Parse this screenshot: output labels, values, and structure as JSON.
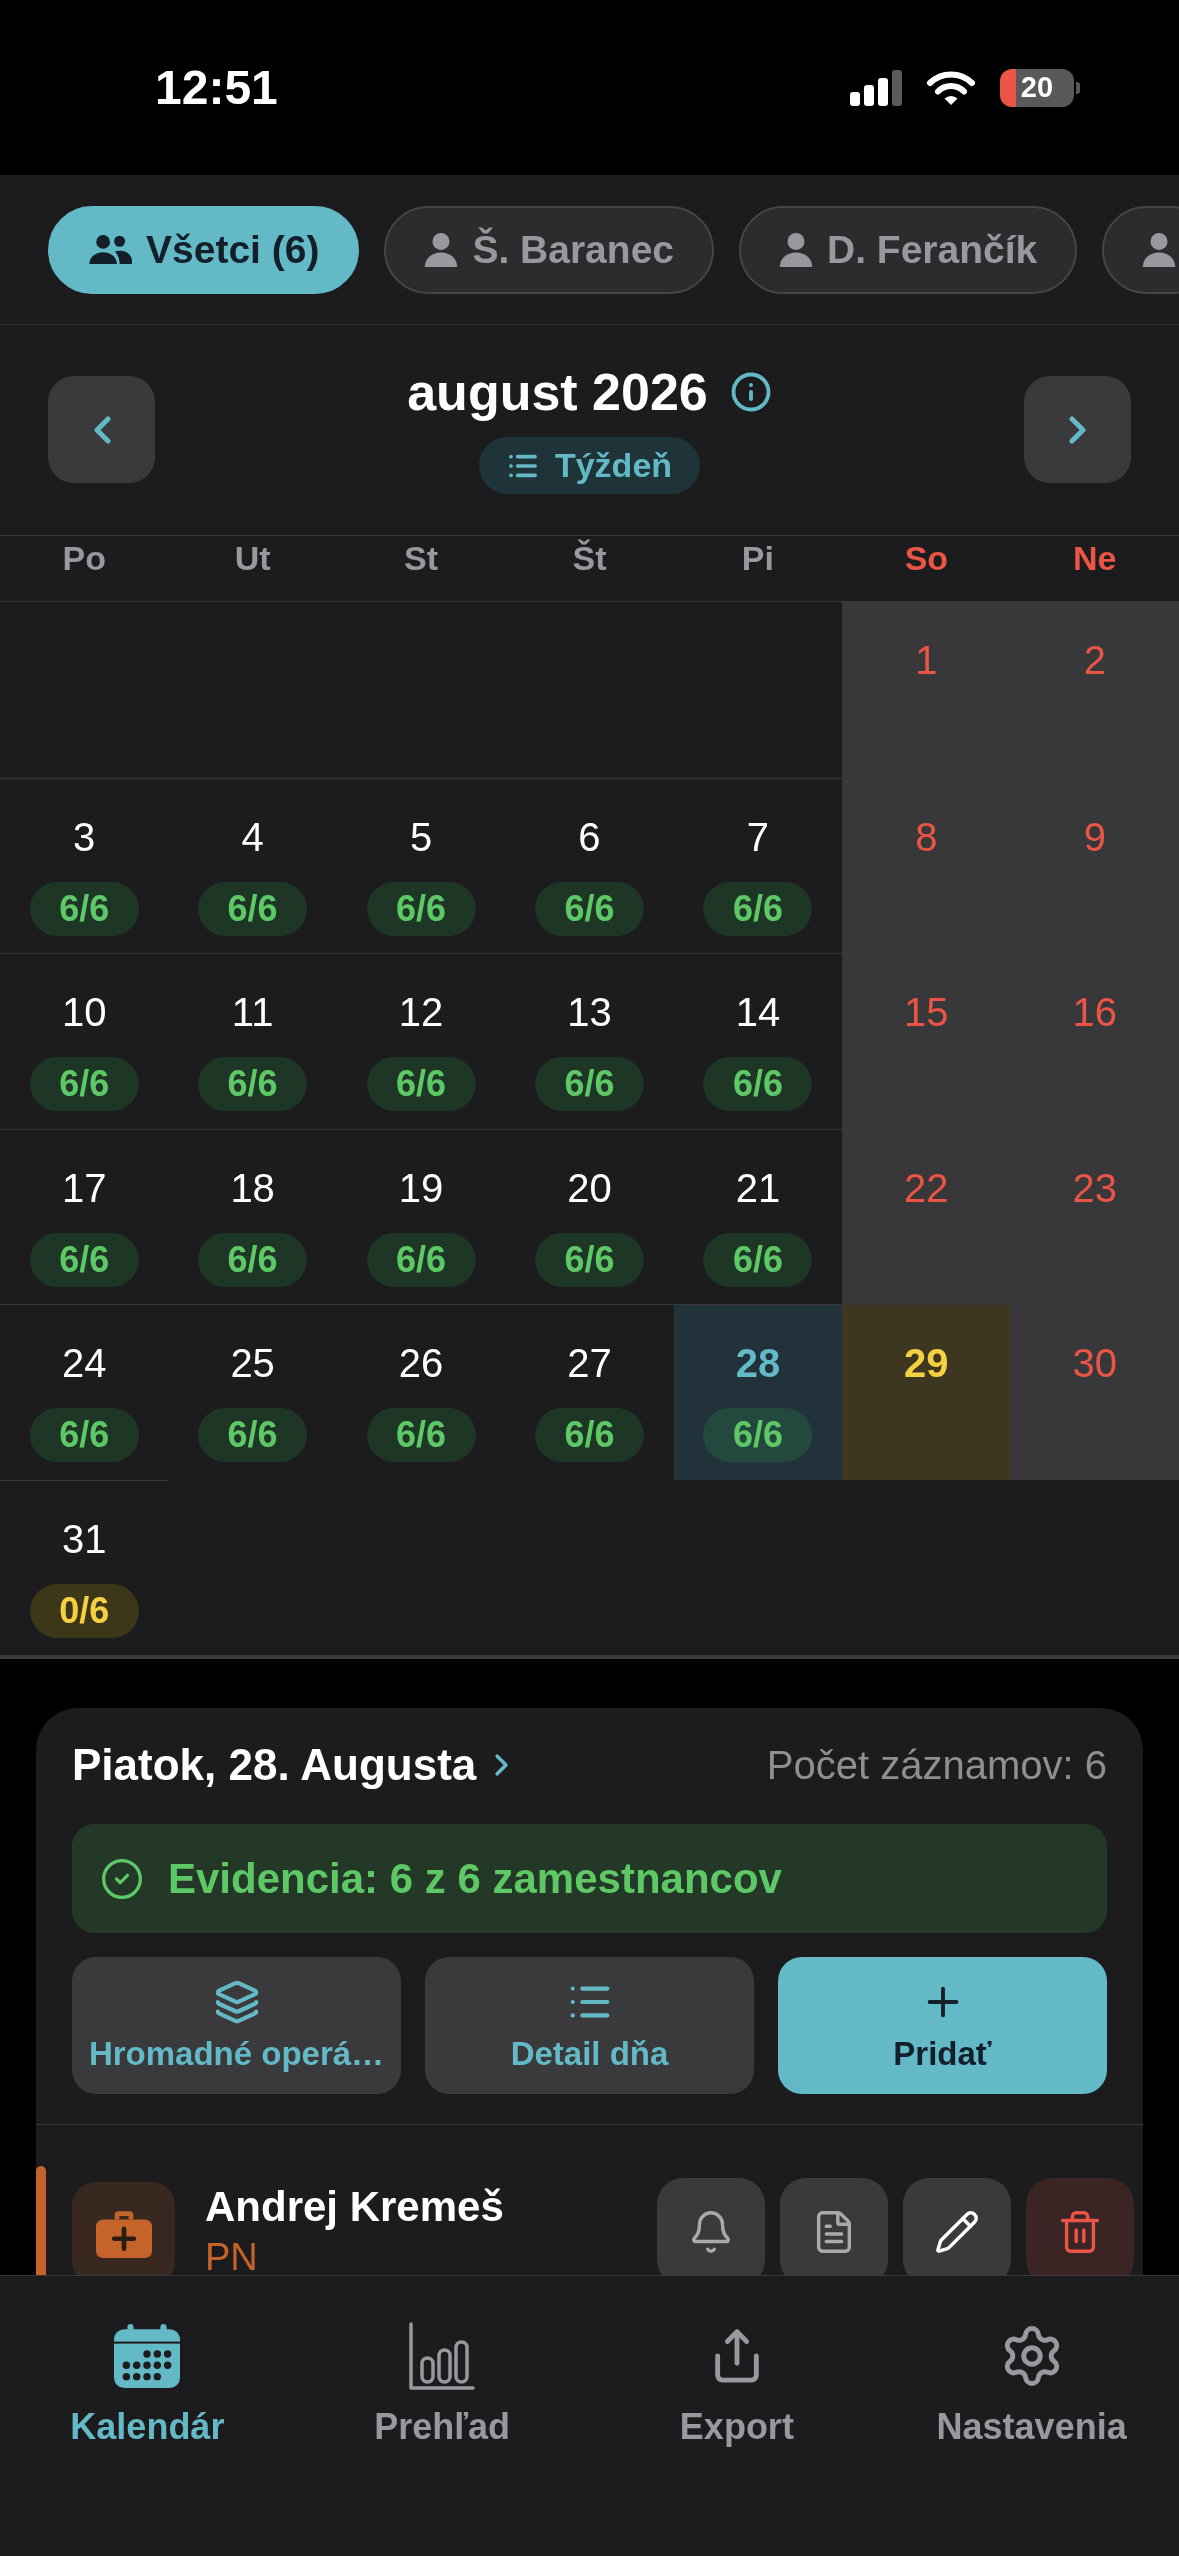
{
  "status_bar": {
    "time": "12:51",
    "battery": "20"
  },
  "filters": {
    "chips": [
      {
        "label": "Všetci (6)",
        "kind": "group",
        "selected": true
      },
      {
        "label": "Š. Baranec",
        "kind": "person",
        "selected": false
      },
      {
        "label": "D. Ferančík",
        "kind": "person",
        "selected": false
      },
      {
        "kind": "person",
        "selected": false
      }
    ]
  },
  "calendar": {
    "title": "august 2026",
    "view_toggle": "Týždeň",
    "weekdays": [
      {
        "label": "Po",
        "weekend": false
      },
      {
        "label": "Ut",
        "weekend": false
      },
      {
        "label": "St",
        "weekend": false
      },
      {
        "label": "Št",
        "weekend": false
      },
      {
        "label": "Pi",
        "weekend": false
      },
      {
        "label": "So",
        "weekend": true
      },
      {
        "label": "Ne",
        "weekend": true
      }
    ],
    "weeks": [
      {
        "pad_start": true,
        "days": [
          {
            "day": "1",
            "weekend": true,
            "selected": false,
            "today": false
          },
          {
            "day": "2",
            "weekend": true,
            "selected": false,
            "today": false
          }
        ]
      },
      {
        "pad_start": false,
        "days": [
          {
            "day": "3",
            "weekend": false,
            "selected": false,
            "today": false,
            "badge": {
              "text": "6/6",
              "complete": true
            }
          },
          {
            "day": "4",
            "weekend": false,
            "selected": false,
            "today": false,
            "badge": {
              "text": "6/6",
              "complete": true
            }
          },
          {
            "day": "5",
            "weekend": false,
            "selected": false,
            "today": false,
            "badge": {
              "text": "6/6",
              "complete": true
            }
          },
          {
            "day": "6",
            "weekend": false,
            "selected": false,
            "today": false,
            "badge": {
              "text": "6/6",
              "complete": true
            }
          },
          {
            "day": "7",
            "weekend": false,
            "selected": false,
            "today": false,
            "badge": {
              "text": "6/6",
              "complete": true
            }
          },
          {
            "day": "8",
            "weekend": true,
            "selected": false,
            "today": false
          },
          {
            "day": "9",
            "weekend": true,
            "selected": false,
            "today": false
          }
        ]
      },
      {
        "pad_start": false,
        "days": [
          {
            "day": "10",
            "weekend": false,
            "selected": false,
            "today": false,
            "badge": {
              "text": "6/6",
              "complete": true
            }
          },
          {
            "day": "11",
            "weekend": false,
            "selected": false,
            "today": false,
            "badge": {
              "text": "6/6",
              "complete": true
            }
          },
          {
            "day": "12",
            "weekend": false,
            "selected": false,
            "today": false,
            "badge": {
              "text": "6/6",
              "complete": true
            }
          },
          {
            "day": "13",
            "weekend": false,
            "selected": false,
            "today": false,
            "badge": {
              "text": "6/6",
              "complete": true
            }
          },
          {
            "day": "14",
            "weekend": false,
            "selected": false,
            "today": false,
            "badge": {
              "text": "6/6",
              "complete": true
            }
          },
          {
            "day": "15",
            "weekend": true,
            "selected": false,
            "today": false
          },
          {
            "day": "16",
            "weekend": true,
            "selected": false,
            "today": false
          }
        ]
      },
      {
        "pad_start": false,
        "days": [
          {
            "day": "17",
            "weekend": false,
            "selected": false,
            "today": false,
            "badge": {
              "text": "6/6",
              "complete": true
            }
          },
          {
            "day": "18",
            "weekend": false,
            "selected": false,
            "today": false,
            "badge": {
              "text": "6/6",
              "complete": true
            }
          },
          {
            "day": "19",
            "weekend": false,
            "selected": false,
            "today": false,
            "badge": {
              "text": "6/6",
              "complete": true
            }
          },
          {
            "day": "20",
            "weekend": false,
            "selected": false,
            "today": false,
            "badge": {
              "text": "6/6",
              "complete": true
            }
          },
          {
            "day": "21",
            "weekend": false,
            "selected": false,
            "today": false,
            "badge": {
              "text": "6/6",
              "complete": true
            }
          },
          {
            "day": "22",
            "weekend": true,
            "selected": false,
            "today": false
          },
          {
            "day": "23",
            "weekend": true,
            "selected": false,
            "today": false
          }
        ]
      },
      {
        "pad_start": false,
        "days": [
          {
            "day": "24",
            "weekend": false,
            "selected": false,
            "today": false,
            "badge": {
              "text": "6/6",
              "complete": true
            }
          },
          {
            "day": "25",
            "weekend": false,
            "selected": false,
            "today": false,
            "badge": {
              "text": "6/6",
              "complete": true
            }
          },
          {
            "day": "26",
            "weekend": false,
            "selected": false,
            "today": false,
            "badge": {
              "text": "6/6",
              "complete": true
            }
          },
          {
            "day": "27",
            "weekend": false,
            "selected": false,
            "today": false,
            "badge": {
              "text": "6/6",
              "complete": true
            }
          },
          {
            "day": "28",
            "weekend": false,
            "selected": true,
            "today": false,
            "badge": {
              "text": "6/6",
              "complete": true
            }
          },
          {
            "day": "29",
            "weekend": true,
            "selected": false,
            "today": true
          },
          {
            "day": "30",
            "weekend": true,
            "selected": false,
            "today": false
          }
        ]
      },
      {
        "pad_start": false,
        "days": [
          {
            "day": "31",
            "weekend": false,
            "selected": false,
            "today": false,
            "badge": {
              "text": "0/6",
              "complete": false
            }
          }
        ]
      }
    ]
  },
  "day_panel": {
    "title": "Piatok, 28. Augusta",
    "record_count": "Počet záznamov: 6",
    "evidence": "Evidencia: 6 z 6 zamestnancov",
    "actions": [
      {
        "label": "Hromadné operá…",
        "kind": "bulk"
      },
      {
        "label": "Detail dňa",
        "kind": "detail"
      },
      {
        "label": "Pridať",
        "kind": "add"
      }
    ],
    "entries": [
      {
        "name": "Andrej Kremeš",
        "type": "PN",
        "color": "#c4632a"
      }
    ]
  },
  "tab_bar": {
    "tabs": [
      {
        "label": "Kalendár",
        "selected": true
      },
      {
        "label": "Prehľad",
        "selected": false
      },
      {
        "label": "Export",
        "selected": false
      },
      {
        "label": "Nastavenia",
        "selected": false
      }
    ]
  }
}
